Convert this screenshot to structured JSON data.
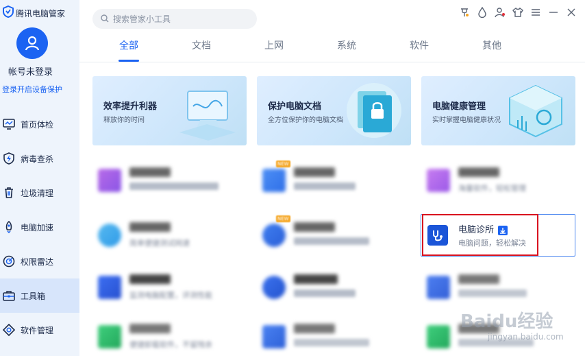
{
  "app": {
    "title": "腾讯电脑管家"
  },
  "account": {
    "name": "帐号未登录",
    "login_prompt": "登录开启设备保护"
  },
  "sidebar": {
    "items": [
      {
        "label": "首页体检",
        "icon": "monitor-icon"
      },
      {
        "label": "病毒查杀",
        "icon": "shield-bolt-icon"
      },
      {
        "label": "垃圾清理",
        "icon": "trash-icon"
      },
      {
        "label": "电脑加速",
        "icon": "rocket-icon"
      },
      {
        "label": "权限雷达",
        "icon": "radar-icon"
      },
      {
        "label": "工具箱",
        "icon": "toolbox-icon",
        "active": true
      },
      {
        "label": "软件管理",
        "icon": "apps-icon"
      }
    ]
  },
  "search": {
    "placeholder": "搜索管家小工具"
  },
  "tabs": [
    "全部",
    "文档",
    "上网",
    "系统",
    "软件",
    "其他"
  ],
  "banners": [
    {
      "title": "效率提升利器",
      "subtitle": "释放你的时间"
    },
    {
      "title": "保护电脑文档",
      "subtitle": "全方位保护你的电脑文档"
    },
    {
      "title": "电脑健康管理",
      "subtitle": "实时掌握电脑健康状况"
    }
  ],
  "tools": {
    "highlight": {
      "title": "电脑诊所",
      "desc": "电脑问题，轻松解决"
    },
    "visible_fragments": {
      "r1c3_desc": "海量软件，轻松管理",
      "r2c1_desc": "简单便捷测试网速",
      "r3c1_desc": "监测电脑配置，评测性能",
      "r4c1_desc": "便捷卸载软件，不留残余"
    }
  },
  "watermark": {
    "main": "Baidu经验",
    "sub": "jingyan.baidu.com"
  },
  "colors": {
    "accent": "#1b63f2",
    "highlight_border": "#d9121f",
    "sidebar_bg": "#eef4fc"
  }
}
